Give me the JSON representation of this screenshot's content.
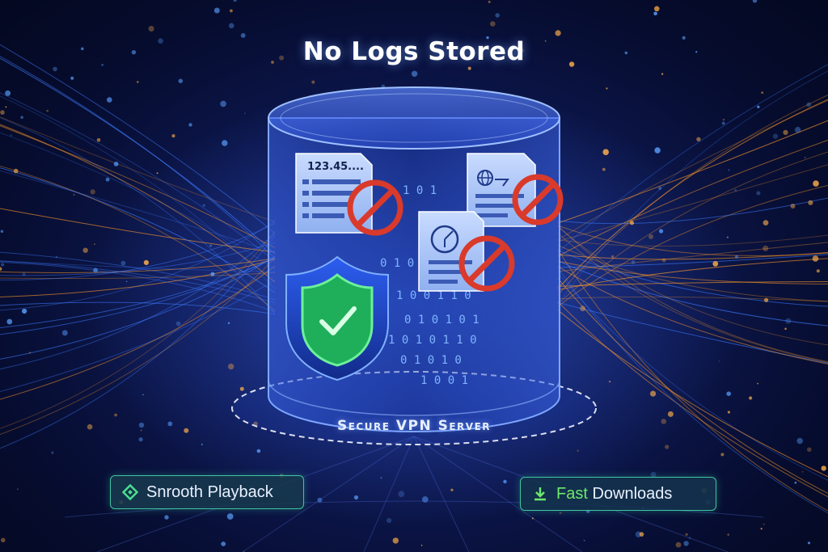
{
  "header": {
    "title": "No Logs Stored"
  },
  "server": {
    "label": "Secure VPN Server",
    "ip_log_text": "123.45....",
    "binary_rows": [
      "1 0 1",
      "0 1 0 1 0 1",
      "1 0 0 1 1 0",
      "0 1 0 1 0 1",
      "1 0 1 0 1 1 0",
      "0 1 0 1 0",
      "1 0 0 1"
    ]
  },
  "features": {
    "left_label": "Snrooth Playback",
    "right_accent": "Fast",
    "right_label": "Downloads"
  },
  "colors": {
    "blocked": "#d93a2b",
    "shield": "#1fae5a",
    "pill_border": "#3ec6a0",
    "glow_blue": "#3d7bff",
    "glow_orange": "#ff9a2a"
  },
  "icons": [
    "no-entry-icon",
    "shield-check-icon",
    "diamond-icon",
    "download-icon",
    "globe-icon",
    "clock-icon"
  ]
}
